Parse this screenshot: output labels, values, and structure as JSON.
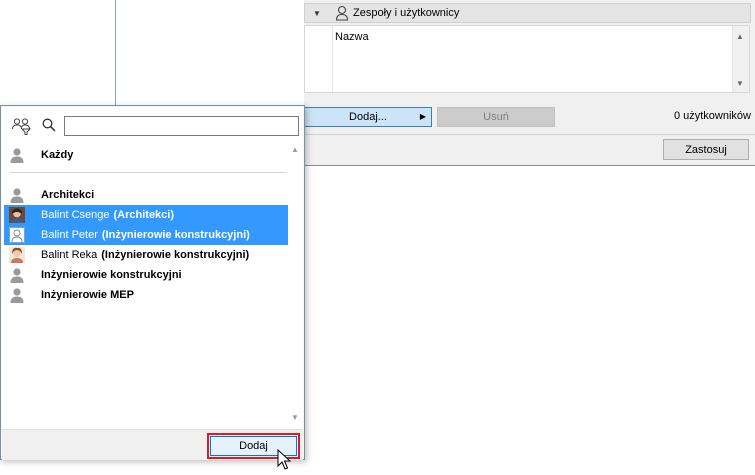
{
  "dialog": {
    "section_title": "Zespoły i użytkownicy",
    "column_header": "Nazwa",
    "add_button": "Dodaj...",
    "remove_button": "Usuń",
    "user_count": "0 użytkowników",
    "apply_button": "Zastosuj"
  },
  "popup": {
    "search_value": "",
    "rows": [
      {
        "name": "Każdy",
        "team": "",
        "bold": true,
        "selected": false,
        "avatar": "generic-user-icon"
      },
      {
        "name": "Architekci",
        "team": "",
        "bold": true,
        "selected": false,
        "avatar": "generic-user-icon"
      },
      {
        "name": "Balint Csenge",
        "team": "(Architekci)",
        "bold": false,
        "selected": true,
        "avatar": "user-photo"
      },
      {
        "name": "Balint Peter",
        "team": "(Inżynierowie konstrukcyjni)",
        "bold": false,
        "selected": true,
        "avatar": "blank-user-photo"
      },
      {
        "name": "Balint Reka",
        "team": "(Inżynierowie konstrukcyjni)",
        "bold": false,
        "selected": false,
        "avatar": "user-photo"
      },
      {
        "name": "Inżynierowie konstrukcyjni",
        "team": "",
        "bold": true,
        "selected": false,
        "avatar": "generic-user-icon"
      },
      {
        "name": "Inżynierowie MEP",
        "team": "",
        "bold": true,
        "selected": false,
        "avatar": "generic-user-icon"
      }
    ],
    "add_button": "Dodaj"
  },
  "colors": {
    "selection": "#3399ff",
    "highlight_box": "#e01a22",
    "primary_button_fill": "#cce4f7"
  }
}
